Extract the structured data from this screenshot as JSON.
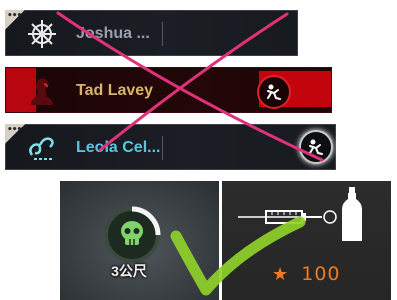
{
  "players": [
    {
      "name": "Joshua ...",
      "role_icon": "ship-wheel-icon",
      "corner_icon": "ellipsis-icon"
    },
    {
      "name": "Tad Lavey",
      "role_icon": "hunter-icon",
      "status_icon": "downed-figure-icon",
      "status_color": "#c4040c"
    },
    {
      "name": "Leola Cel...",
      "role_icon": "chain-icon",
      "corner_icon": "ellipsis-icon",
      "status_icon": "downed-figure-icon"
    }
  ],
  "distance_marker": {
    "icon": "skull-icon",
    "label": "3公尺"
  },
  "score_panel": {
    "tools": [
      "syringe-icon",
      "bottle-icon"
    ],
    "star_icon": "★",
    "score": "100",
    "accent_color": "#f07a1f"
  },
  "overlays": {
    "cross_color": "#e0327a",
    "check_color": "#8fd12a"
  }
}
